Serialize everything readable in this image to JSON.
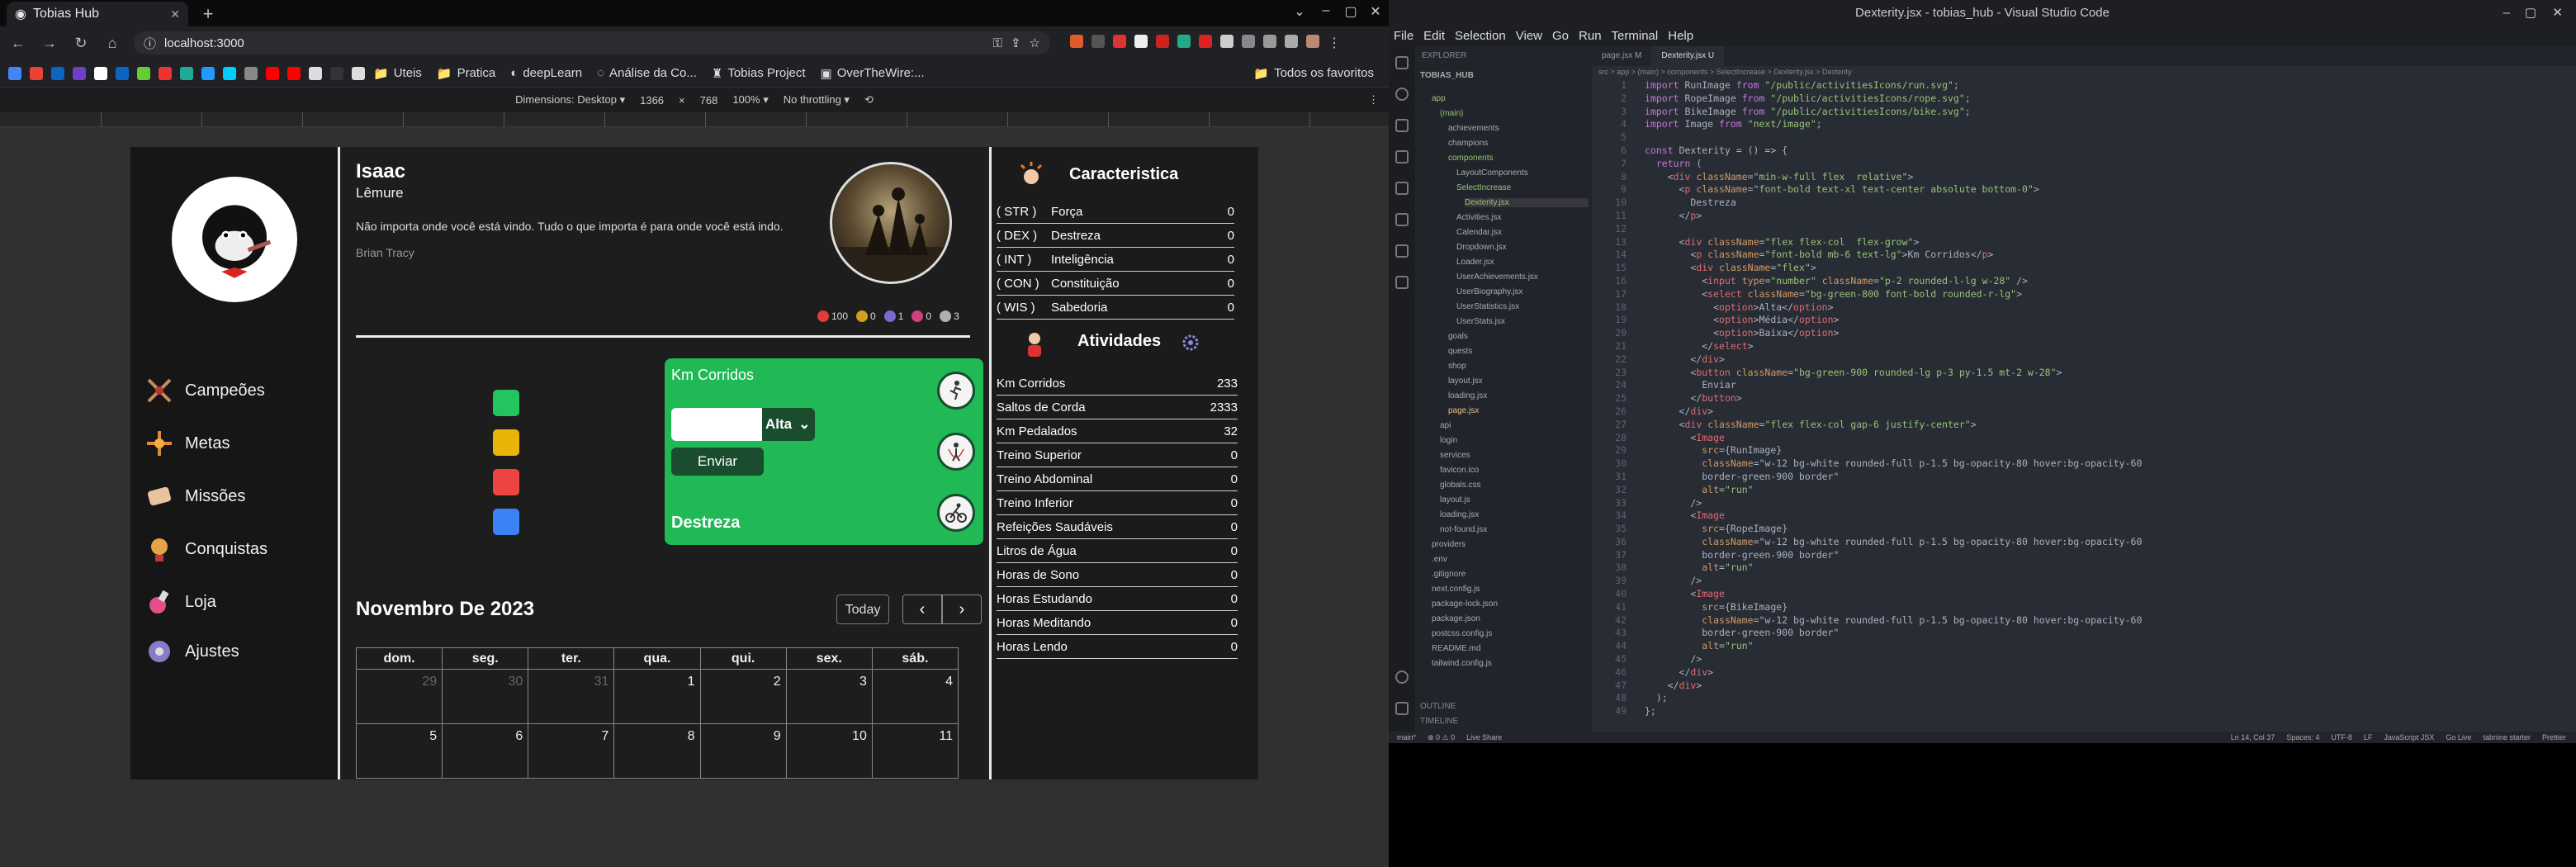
{
  "browser": {
    "tab_title": "Tobias Hub",
    "url": "localhost:3000",
    "bookmarks": [
      "Uteis",
      "Pratica",
      "deepLearn",
      "Análise da Co...",
      "Tobias Project",
      "OverTheWire:..."
    ],
    "bookmarks_folder": "Todos os favoritos",
    "device_toolbar": {
      "dimensions": "Dimensions: Desktop ▾",
      "width": "1366",
      "height": "768",
      "zoom": "100% ▾",
      "throttle": "No throttling ▾"
    }
  },
  "app": {
    "profile": {
      "name": "Isaac",
      "title": "Lêmure",
      "quote": "Não importa onde você está vindo. Tudo o que importa é para onde você está indo.",
      "author": "Brian Tracy"
    },
    "badges": [
      {
        "value": "100",
        "color": "#e23b3b"
      },
      {
        "value": "0",
        "color": "#d0a020"
      },
      {
        "value": "1",
        "color": "#7a6ad0"
      },
      {
        "value": "0",
        "color": "#d04080"
      },
      {
        "value": "3",
        "color": "#b0b0b0"
      }
    ],
    "nav": [
      {
        "label": "Campeões",
        "icon": "swords-icon"
      },
      {
        "label": "Metas",
        "icon": "target-icon"
      },
      {
        "label": "Missões",
        "icon": "scroll-icon"
      },
      {
        "label": "Conquistas",
        "icon": "trophy-icon"
      },
      {
        "label": "Loja",
        "icon": "potion-icon"
      },
      {
        "label": "Ajustes",
        "icon": "settings-icon"
      }
    ],
    "dexterity_card": {
      "title": "Km Corridos",
      "select_value": "Alta",
      "send_label": "Enviar",
      "footer": "Destreza",
      "colors": [
        "#22c55e",
        "#eab308",
        "#ef4444",
        "#3b82f6"
      ]
    },
    "calendar": {
      "title": "Novembro De 2023",
      "today_label": "Today",
      "prev": "‹",
      "next": "›",
      "weekdays": [
        "dom.",
        "seg.",
        "ter.",
        "qua.",
        "qui.",
        "sex.",
        "sáb."
      ],
      "weeks": [
        [
          "29",
          "30",
          "31",
          "1",
          "2",
          "3",
          "4"
        ],
        [
          "5",
          "6",
          "7",
          "8",
          "9",
          "10",
          "11"
        ]
      ]
    },
    "characteristics": {
      "title": "Caracteristica",
      "stats": [
        {
          "abbr": "( STR )",
          "name": "Força",
          "value": "0"
        },
        {
          "abbr": "( DEX )",
          "name": "Destreza",
          "value": "0"
        },
        {
          "abbr": "( INT )",
          "name": "Inteligência",
          "value": "0"
        },
        {
          "abbr": "( CON )",
          "name": "Constituição",
          "value": "0"
        },
        {
          "abbr": "( WIS )",
          "name": "Sabedoria",
          "value": "0"
        }
      ]
    },
    "activities": {
      "title": "Atividades",
      "items": [
        {
          "name": "Km Corridos",
          "value": "233"
        },
        {
          "name": "Saltos de Corda",
          "value": "2333"
        },
        {
          "name": "Km Pedalados",
          "value": "32"
        },
        {
          "name": "Treino Superior",
          "value": "0"
        },
        {
          "name": "Treino Abdominal",
          "value": "0"
        },
        {
          "name": "Treino Inferior",
          "value": "0"
        },
        {
          "name": "Refeições Saudáveis",
          "value": "0"
        },
        {
          "name": "Litros de Água",
          "value": "0"
        },
        {
          "name": "Horas de Sono",
          "value": "0"
        },
        {
          "name": "Horas Estudando",
          "value": "0"
        },
        {
          "name": "Horas Meditando",
          "value": "0"
        },
        {
          "name": "Horas Lendo",
          "value": "0"
        }
      ]
    }
  },
  "vscode": {
    "title": "Dexterity.jsx - tobias_hub - Visual Studio Code",
    "menu": [
      "File",
      "Edit",
      "Selection",
      "View",
      "Go",
      "Run",
      "Terminal",
      "Help"
    ],
    "tabs": [
      "page.jsx M",
      "Dexterity.jsx U"
    ],
    "breadcrumb": "src > app > (main) > components > SelectIncrease > Dexterity.jsx > Dexterity",
    "explorer_title": "EXPLORER",
    "project": "TOBIAS_HUB",
    "tree": [
      "app",
      "(main)",
      "achievements",
      "champions",
      "components",
      "LayoutComponents",
      "SelectIncrease",
      "Dexterity.jsx",
      "Activities.jsx",
      "Calendar.jsx",
      "Dropdown.jsx",
      "Loader.jsx",
      "UserAchievements.jsx",
      "UserBiography.jsx",
      "UserStatistics.jsx",
      "UserStats.jsx",
      "goals",
      "quests",
      "shop",
      "layout.jsx",
      "loading.jsx",
      "page.jsx",
      "api",
      "login",
      "services",
      "favicon.ico",
      "globals.css",
      "layout.js",
      "loading.jsx",
      "not-found.jsx",
      "providers",
      ".env",
      ".gitignore",
      "next.config.js",
      "package-lock.json",
      "package.json",
      "postcss.config.js",
      "README.md",
      "tailwind.config.js"
    ],
    "outline": "OUTLINE",
    "timeline": "TIMELINE",
    "code": [
      "import RunImage from \"/public/activitiesIcons/run.svg\";",
      "import RopeImage from \"/public/activitiesIcons/rope.svg\";",
      "import BikeImage from \"/public/activitiesIcons/bike.svg\";",
      "import Image from \"next/image\";",
      "",
      "const Dexterity = () => {",
      "  return (",
      "    <div className=\"min-w-full flex  relative\">",
      "      <p className=\"font-bold text-xl text-center absolute bottom-0\">",
      "        Destreza",
      "      </p>",
      "",
      "      <div className=\"flex flex-col  flex-grow\">",
      "        <p className=\"font-bold mb-6 text-lg\">Km Corridos</p>",
      "        <div className=\"flex\">",
      "          <input type=\"number\" className=\"p-2 rounded-l-lg w-28\" />",
      "          <select className=\"bg-green-800 font-bold rounded-r-lg\">",
      "            <option>Alta</option>",
      "            <option>Média</option>",
      "            <option>Baixa</option>",
      "          </select>",
      "        </div>",
      "        <button className=\"bg-green-900 rounded-lg p-3 py-1.5 mt-2 w-28\">",
      "          Enviar",
      "        </button>",
      "      </div>",
      "      <div className=\"flex flex-col gap-6 justify-center\">",
      "        <Image",
      "          src={RunImage}",
      "          className=\"w-12 bg-white rounded-full p-1.5 bg-opacity-80 hover:bg-opacity-60",
      "          border-green-900 border\"",
      "          alt=\"run\"",
      "        />",
      "        <Image",
      "          src={RopeImage}",
      "          className=\"w-12 bg-white rounded-full p-1.5 bg-opacity-80 hover:bg-opacity-60",
      "          border-green-900 border\"",
      "          alt=\"run\"",
      "        />",
      "        <Image",
      "          src={BikeImage}",
      "          className=\"w-12 bg-white rounded-full p-1.5 bg-opacity-80 hover:bg-opacity-60",
      "          border-green-900 border\"",
      "          alt=\"run\"",
      "        />",
      "      </div>",
      "    </div>",
      "  );",
      "};"
    ],
    "status": [
      "main*",
      "⊗ 0 ⚠ 0",
      "Live Share",
      "Ln 14, Col 37",
      "Spaces: 4",
      "UTF-8",
      "LF",
      "JavaScript JSX",
      "Go Live",
      "tabnine starter",
      "Prettier"
    ]
  }
}
